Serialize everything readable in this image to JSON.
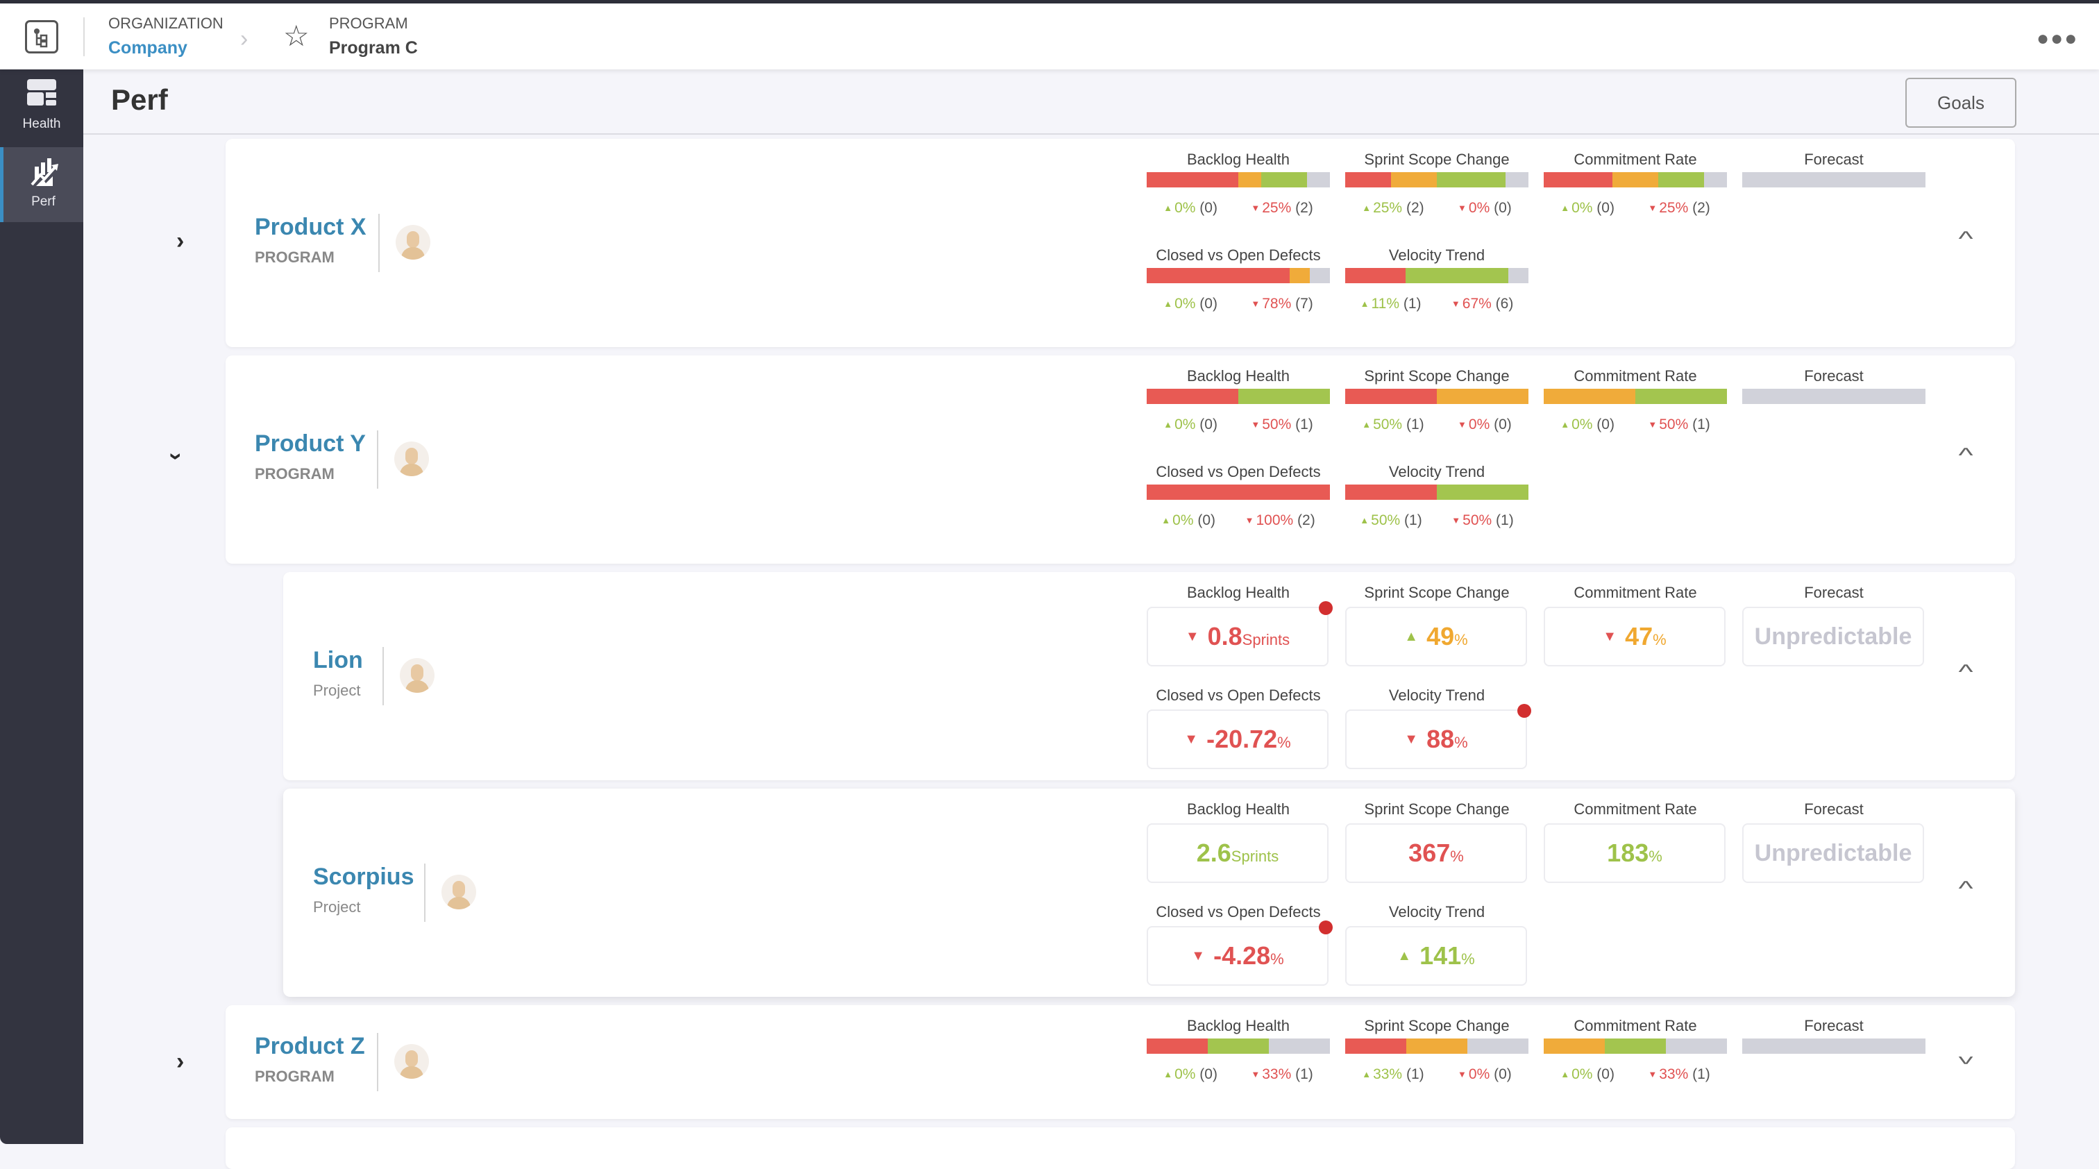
{
  "colors": {
    "accent": "#3b87b0",
    "red": "#e85a54",
    "orange": "#f0ab3a",
    "green": "#a3c54f",
    "gray": "#d1d2da",
    "up_text": "#9ec24a",
    "down_text": "#e05252",
    "orange_text": "#f0a830",
    "alert_dot": "#d22f2f"
  },
  "topbar": {
    "org_label": "ORGANIZATION",
    "org_value": "Company",
    "program_label": "PROGRAM",
    "program_value": "Program C",
    "more_icon": "more-horizontal-icon"
  },
  "sidebar": {
    "items": [
      {
        "label": "Health",
        "icon": "dashboard-icon",
        "active": false
      },
      {
        "label": "Perf",
        "icon": "performance-chart-icon",
        "active": true
      }
    ]
  },
  "page": {
    "title": "Perf",
    "goals_label": "Goals",
    "history_icon": "history-icon"
  },
  "metric_titles": {
    "backlog": "Backlog Health",
    "scope": "Sprint Scope Change",
    "commit": "Commitment Rate",
    "forecast": "Forecast",
    "defects": "Closed vs Open Defects",
    "velocity": "Velocity Trend"
  },
  "rows": [
    {
      "name": "Product X",
      "type": "PROGRAM",
      "expanded": false,
      "collapsed_view": false,
      "metrics": {
        "backlog": {
          "segments": {
            "red": 50,
            "orange": 12.5,
            "green": 25,
            "gray": 12.5
          },
          "up": "0%",
          "up_count": "(0)",
          "down": "25%",
          "down_count": "(2)"
        },
        "scope": {
          "segments": {
            "red": 25,
            "orange": 25,
            "green": 37.5,
            "gray": 12.5
          },
          "up": "25%",
          "up_count": "(2)",
          "down": "0%",
          "down_count": "(0)"
        },
        "commit": {
          "segments": {
            "red": 37.5,
            "orange": 25,
            "green": 25,
            "gray": 12.5
          },
          "up": "0%",
          "up_count": "(0)",
          "down": "25%",
          "down_count": "(2)"
        },
        "forecast": {
          "segments": {
            "red": 0,
            "orange": 0,
            "green": 0,
            "gray": 100
          }
        },
        "defects": {
          "segments": {
            "red": 78,
            "orange": 11,
            "green": 0,
            "gray": 11
          },
          "up": "0%",
          "up_count": "(0)",
          "down": "78%",
          "down_count": "(7)"
        },
        "velocity": {
          "segments": {
            "red": 33,
            "orange": 0,
            "green": 56,
            "gray": 11
          },
          "up": "11%",
          "up_count": "(1)",
          "down": "67%",
          "down_count": "(6)"
        }
      }
    },
    {
      "name": "Product Y",
      "type": "PROGRAM",
      "expanded": true,
      "metrics": {
        "backlog": {
          "segments": {
            "red": 50,
            "orange": 0,
            "green": 50,
            "gray": 0
          },
          "up": "0%",
          "up_count": "(0)",
          "down": "50%",
          "down_count": "(1)"
        },
        "scope": {
          "segments": {
            "red": 50,
            "orange": 50,
            "green": 0,
            "gray": 0
          },
          "up": "50%",
          "up_count": "(1)",
          "down": "0%",
          "down_count": "(0)"
        },
        "commit": {
          "segments": {
            "red": 0,
            "orange": 50,
            "green": 50,
            "gray": 0
          },
          "up": "0%",
          "up_count": "(0)",
          "down": "50%",
          "down_count": "(1)"
        },
        "forecast": {
          "segments": {
            "red": 0,
            "orange": 0,
            "green": 0,
            "gray": 100
          }
        },
        "defects": {
          "segments": {
            "red": 100,
            "orange": 0,
            "green": 0,
            "gray": 0
          },
          "up": "0%",
          "up_count": "(0)",
          "down": "100%",
          "down_count": "(2)"
        },
        "velocity": {
          "segments": {
            "red": 50,
            "orange": 0,
            "green": 50,
            "gray": 0
          },
          "up": "50%",
          "up_count": "(1)",
          "down": "50%",
          "down_count": "(1)"
        }
      }
    },
    {
      "name": "Lion",
      "type": "Project",
      "values": {
        "backlog": {
          "value": "0.8",
          "unit": "Sprints",
          "trend": "down",
          "trend_color": "red",
          "value_color": "red",
          "alert": true
        },
        "scope": {
          "value": "49",
          "unit": "%",
          "trend": "up",
          "trend_color": "green",
          "value_color": "orange",
          "alert": false
        },
        "commit": {
          "value": "47",
          "unit": "%",
          "trend": "down",
          "trend_color": "red",
          "value_color": "orange",
          "alert": false
        },
        "forecast": {
          "value": "Unpredictable"
        },
        "defects": {
          "value": "-20.72",
          "unit": "%",
          "trend": "down",
          "trend_color": "red",
          "value_color": "red",
          "alert": false
        },
        "velocity": {
          "value": "88",
          "unit": "%",
          "trend": "down",
          "trend_color": "red",
          "value_color": "red",
          "alert": true
        }
      }
    },
    {
      "name": "Scorpius",
      "type": "Project",
      "values": {
        "backlog": {
          "value": "2.6",
          "unit": "Sprints",
          "trend": "none",
          "value_color": "green",
          "alert": false
        },
        "scope": {
          "value": "367",
          "unit": "%",
          "trend": "none",
          "value_color": "red",
          "alert": false
        },
        "commit": {
          "value": "183",
          "unit": "%",
          "trend": "none",
          "value_color": "green",
          "alert": false
        },
        "forecast": {
          "value": "Unpredictable"
        },
        "defects": {
          "value": "-4.28",
          "unit": "%",
          "trend": "down",
          "trend_color": "red",
          "value_color": "red",
          "alert": true
        },
        "velocity": {
          "value": "141",
          "unit": "%",
          "trend": "up",
          "trend_color": "green",
          "value_color": "green",
          "alert": false
        }
      }
    },
    {
      "name": "Product Z",
      "type": "PROGRAM",
      "expanded": false,
      "metrics": {
        "backlog": {
          "segments": {
            "red": 33.3,
            "orange": 0,
            "green": 33.3,
            "gray": 33.4
          },
          "up": "0%",
          "up_count": "(0)",
          "down": "33%",
          "down_count": "(1)"
        },
        "scope": {
          "segments": {
            "red": 33.3,
            "orange": 33.3,
            "green": 0,
            "gray": 33.4
          },
          "up": "33%",
          "up_count": "(1)",
          "down": "0%",
          "down_count": "(0)"
        },
        "commit": {
          "segments": {
            "red": 0,
            "orange": 33.3,
            "green": 33.3,
            "gray": 33.4
          },
          "up": "0%",
          "up_count": "(0)",
          "down": "33%",
          "down_count": "(1)"
        },
        "forecast": {
          "segments": {
            "red": 0,
            "orange": 0,
            "green": 0,
            "gray": 100
          }
        }
      }
    }
  ]
}
